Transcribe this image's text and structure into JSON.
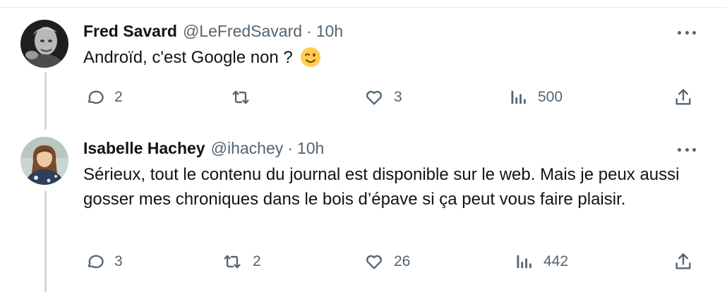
{
  "tweets": [
    {
      "name": "Fred Savard",
      "handle": "@LeFredSavard",
      "separator": "·",
      "time": "10h",
      "text": "Androïd, c'est Google non ?",
      "emoji_icon": "winking-face-emoji",
      "avatar_icon": "user-avatar-photo",
      "stats": {
        "replies": "2",
        "retweets": "",
        "likes": "3",
        "views": "500"
      }
    },
    {
      "name": "Isabelle Hachey",
      "handle": "@ihachey",
      "separator": "·",
      "time": "10h",
      "text": "Sérieux, tout le contenu du journal est disponible sur le web. Mais je peux aussi gosser mes chroniques dans le bois d’épave si ça peut vous faire plaisir.",
      "avatar_icon": "user-avatar-photo",
      "stats": {
        "replies": "3",
        "retweets": "2",
        "likes": "26",
        "views": "442"
      }
    }
  ],
  "colors": {
    "text": "#0f1419",
    "secondary": "#536471",
    "thread_line": "#cfd9de"
  },
  "icons": [
    "reply-icon",
    "retweet-icon",
    "like-icon",
    "views-icon",
    "share-icon",
    "more-icon"
  ]
}
